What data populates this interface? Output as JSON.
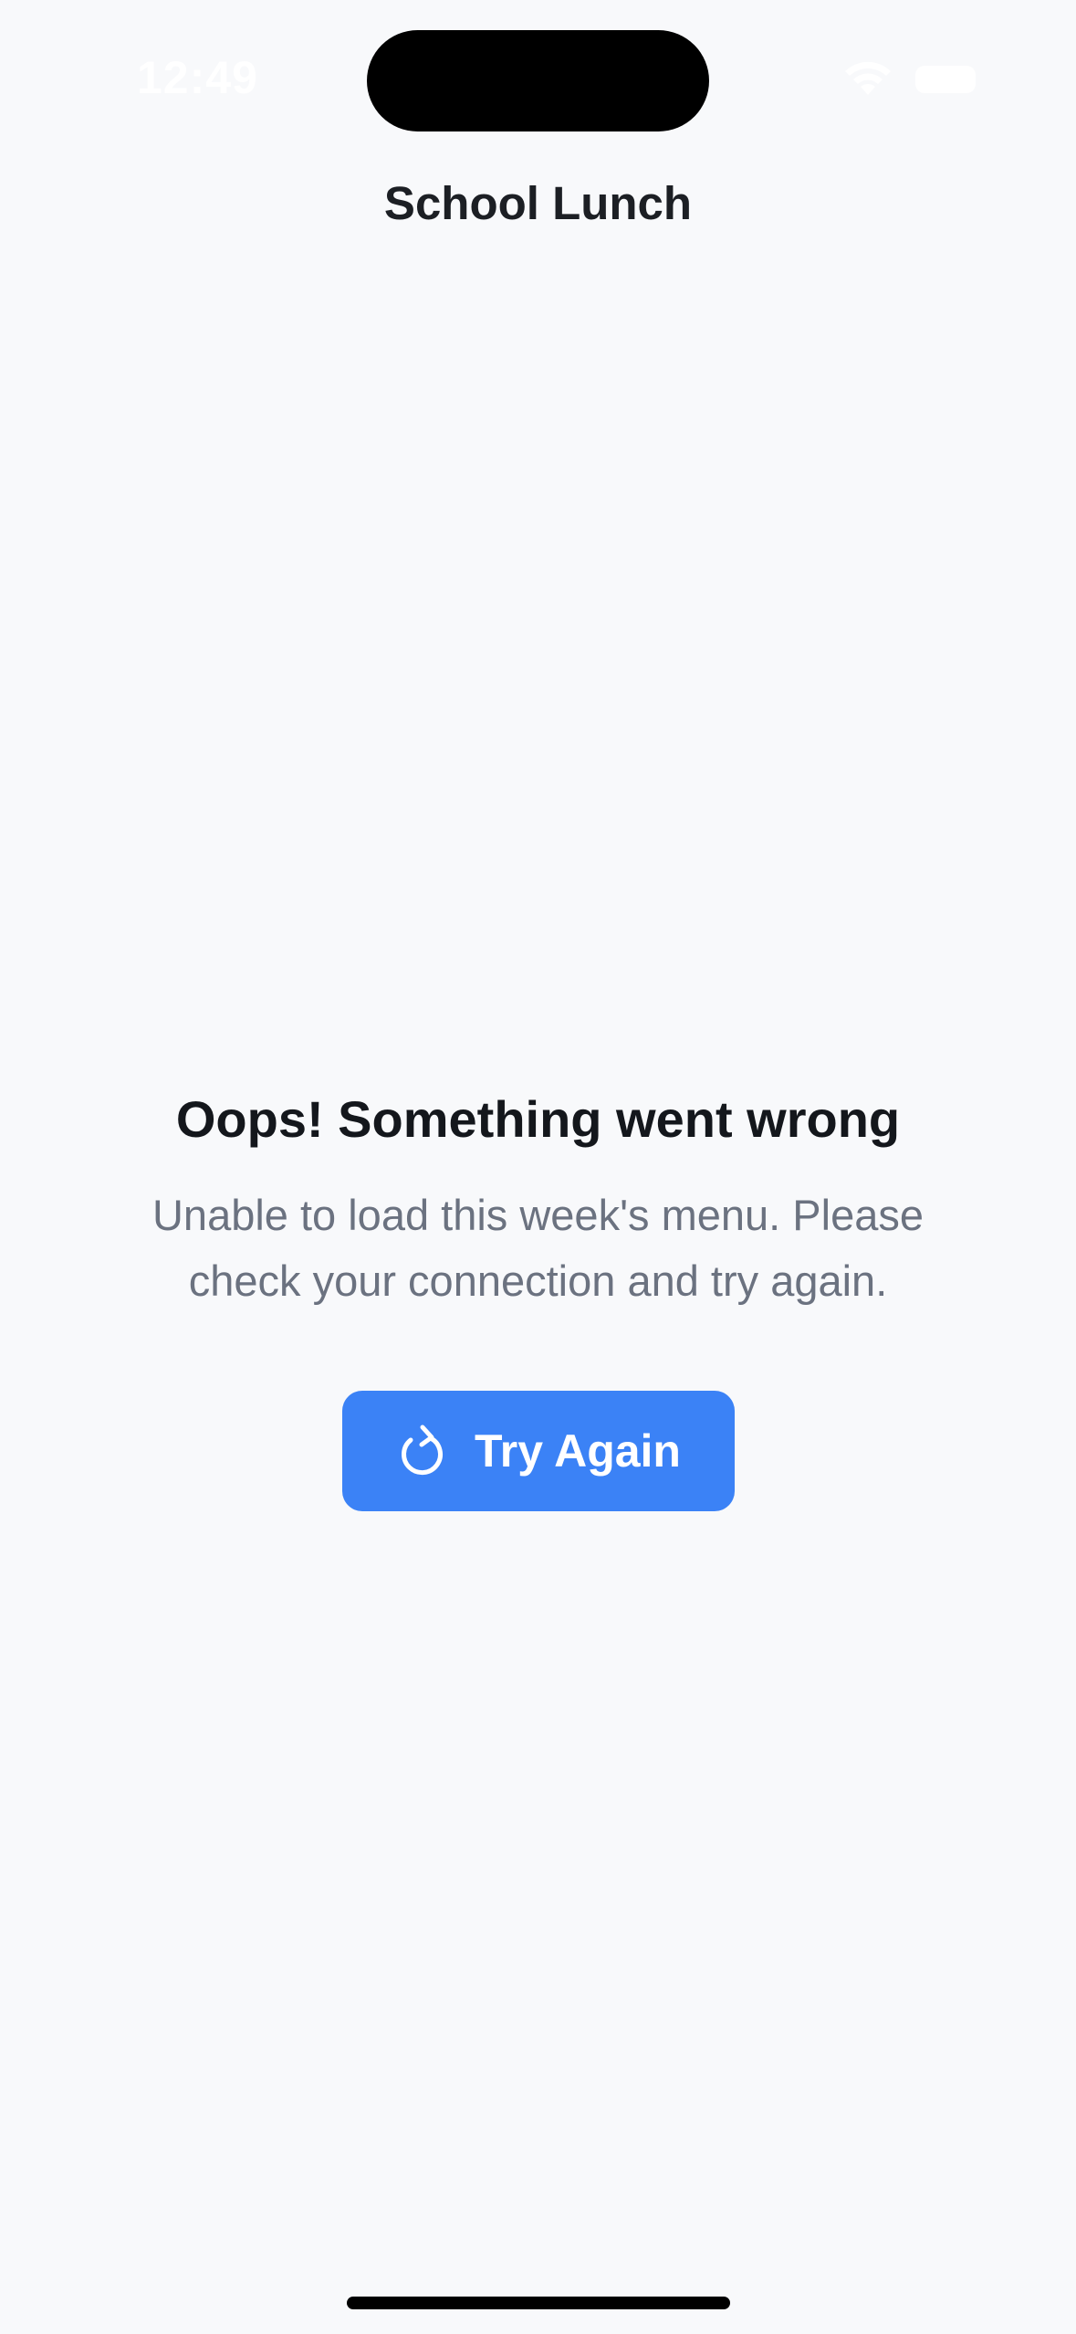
{
  "status_bar": {
    "time": "12:49",
    "wifi_icon": "wifi-icon",
    "battery_icon": "battery-icon"
  },
  "nav": {
    "title": "School Lunch"
  },
  "error": {
    "title": "Oops! Something went wrong",
    "message": "Unable to load this week's menu. Please check your connection and try again."
  },
  "retry_button": {
    "label": "Try Again",
    "icon": "refresh-icon"
  },
  "colors": {
    "background": "#f8f9fb",
    "accent": "#3b82f6",
    "title_text": "#14171c",
    "secondary_text": "#6b7280"
  }
}
